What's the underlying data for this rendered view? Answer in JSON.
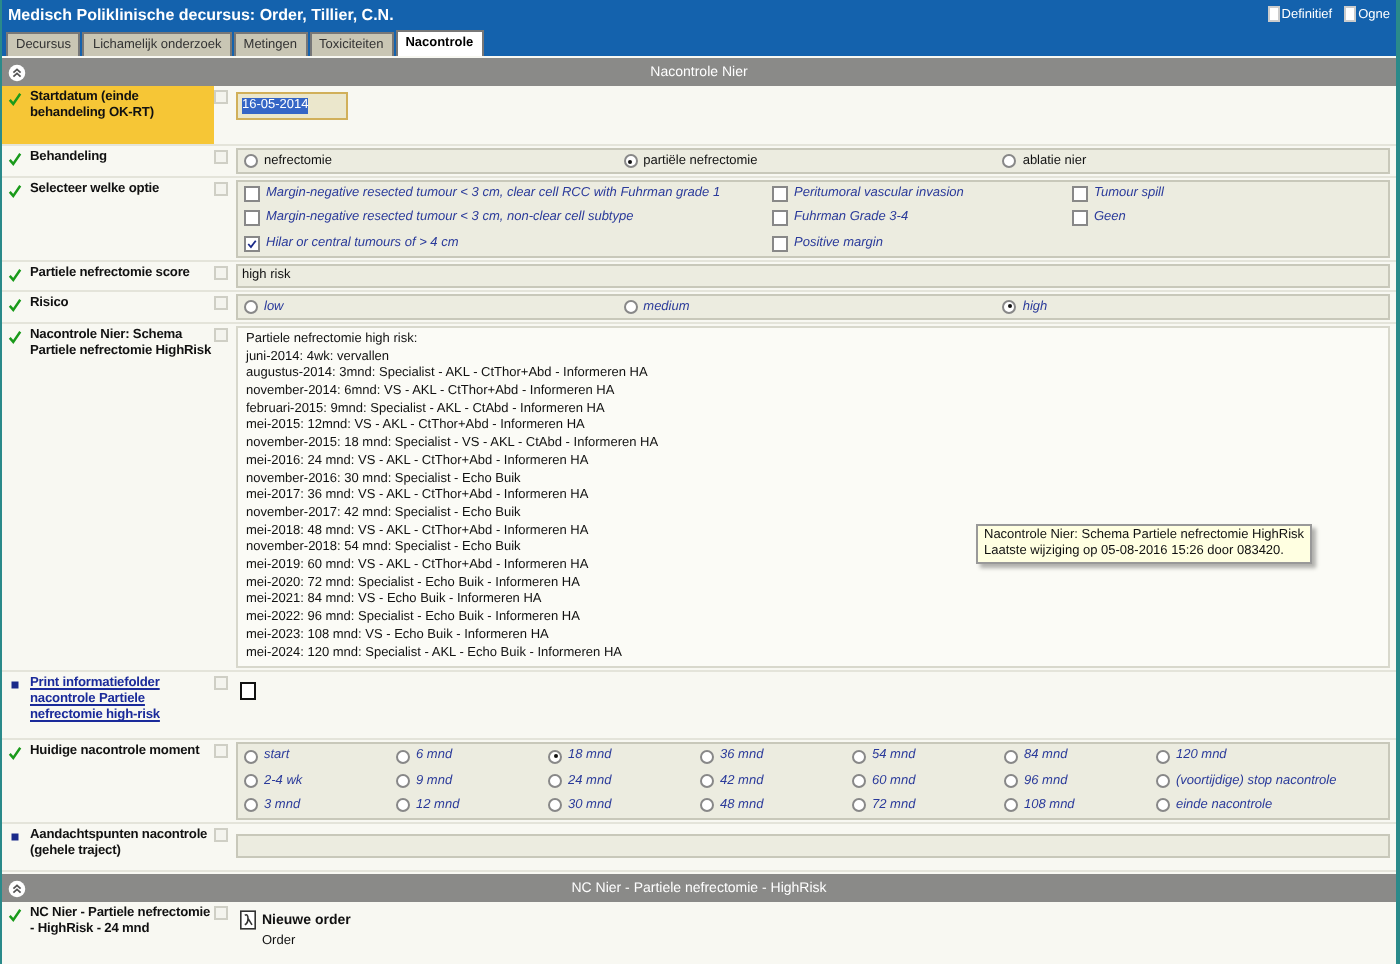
{
  "window": {
    "title": "Medisch Poliklinische decursus: Order, Tillier, C.N.",
    "header_options": [
      {
        "label": "Definitief",
        "checked": false
      },
      {
        "label": "Ogne",
        "checked": false
      }
    ]
  },
  "tabs": [
    {
      "label": "Decursus",
      "selected": false
    },
    {
      "label": "Lichamelijk onderzoek",
      "selected": false
    },
    {
      "label": "Metingen",
      "selected": false
    },
    {
      "label": "Toxiciteiten",
      "selected": false
    },
    {
      "label": "Nacontrole",
      "selected": true
    }
  ],
  "sections": [
    {
      "title": "Nacontrole Nier",
      "expanded": true,
      "rows": [
        {
          "kind": "date",
          "label": "Startdatum (einde behandeling OK-RT)",
          "done": true,
          "highlighted": true,
          "row_checked": false,
          "value": "16-05-2014",
          "text_selected": true
        },
        {
          "kind": "radio",
          "label": "Behandeling",
          "done": true,
          "highlighted": false,
          "row_checked": false,
          "italic": false,
          "options": [
            {
              "label": "nefrectomie",
              "selected": false
            },
            {
              "label": "partiële nefrectomie",
              "selected": true
            },
            {
              "label": "ablatie nier",
              "selected": false
            }
          ]
        },
        {
          "kind": "checks",
          "label": "Selecteer welke optie",
          "done": true,
          "highlighted": false,
          "row_checked": false,
          "columns": [
            [
              {
                "label": "Margin-negative resected tumour < 3 cm, clear cell RCC with Fuhrman grade 1",
                "checked": false
              },
              {
                "label": "Margin-negative resected tumour < 3 cm, non-clear cell subtype",
                "checked": false
              },
              {
                "label": "Hilar or central tumours of > 4 cm",
                "checked": true
              }
            ],
            [
              {
                "label": "Peritumoral vascular invasion",
                "checked": false
              },
              {
                "label": "Fuhrman Grade 3-4",
                "checked": false
              },
              {
                "label": "Positive margin",
                "checked": false
              }
            ],
            [
              {
                "label": "Tumour spill",
                "checked": false
              },
              {
                "label": "Geen",
                "checked": false
              }
            ]
          ]
        },
        {
          "kind": "text",
          "label": "Partiele nefrectomie score",
          "done": true,
          "highlighted": false,
          "row_checked": false,
          "value": "high risk"
        },
        {
          "kind": "radio",
          "label": "Risico",
          "done": true,
          "highlighted": false,
          "row_checked": false,
          "italic": true,
          "options": [
            {
              "label": "low",
              "selected": false
            },
            {
              "label": "medium",
              "selected": false
            },
            {
              "label": "high",
              "selected": true
            }
          ]
        },
        {
          "kind": "schedule",
          "label": "Nacontrole Nier: Schema Partiele nefrectomie HighRisk",
          "done": true,
          "highlighted": false,
          "row_checked": false,
          "lines": [
            "Partiele nefrectomie high risk:",
            "juni-2014: 4wk: vervallen",
            "augustus-2014: 3mnd: Specialist - AKL - CtThor+Abd - Informeren HA",
            "november-2014: 6mnd: VS - AKL - CtThor+Abd - Informeren HA",
            "februari-2015: 9mnd: Specialist - AKL - CtAbd - Informeren HA",
            "mei-2015: 12mnd: VS - AKL - CtThor+Abd - Informeren HA",
            "november-2015: 18 mnd: Specialist - VS - AKL - CtAbd - Informeren HA",
            "mei-2016: 24 mnd: VS - AKL - CtThor+Abd - Informeren HA",
            "november-2016: 30 mnd: Specialist - Echo Buik",
            "mei-2017: 36 mnd: VS - AKL - CtThor+Abd - Informeren HA",
            "november-2017: 42 mnd: Specialist - Echo Buik",
            "mei-2018: 48 mnd: VS - AKL - CtThor+Abd - Informeren HA",
            "november-2018: 54 mnd: Specialist - Echo Buik",
            "mei-2019: 60 mnd: VS - AKL - CtThor+Abd - Informeren HA",
            "mei-2020: 72 mnd: Specialist - Echo Buik - Informeren HA",
            "mei-2021: 84 mnd: VS - Echo Buik - Informeren HA",
            "mei-2022: 96 mnd: Specialist - Echo Buik - Informeren HA",
            "mei-2023: 108 mnd: VS - Echo Buik - Informeren HA",
            "mei-2024: 120 mnd: Specialist - AKL - Echo Buik - Informeren HA"
          ]
        },
        {
          "kind": "print",
          "label": "Print informatiefolder nacontrole Partiele nefrectomie high-risk",
          "done": false,
          "highlighted": false,
          "row_checked": false,
          "checked": false
        },
        {
          "kind": "radiogrid",
          "label": "Huidige nacontrole moment",
          "done": true,
          "highlighted": false,
          "row_checked": false,
          "columns": [
            [
              {
                "label": "start",
                "selected": false
              },
              {
                "label": "2-4 wk",
                "selected": false
              },
              {
                "label": "3 mnd",
                "selected": false
              }
            ],
            [
              {
                "label": "6 mnd",
                "selected": false
              },
              {
                "label": "9 mnd",
                "selected": false
              },
              {
                "label": "12 mnd",
                "selected": false
              }
            ],
            [
              {
                "label": "18 mnd",
                "selected": true
              },
              {
                "label": "24 mnd",
                "selected": false
              },
              {
                "label": "30 mnd",
                "selected": false
              }
            ],
            [
              {
                "label": "36 mnd",
                "selected": false
              },
              {
                "label": "42 mnd",
                "selected": false
              },
              {
                "label": "48 mnd",
                "selected": false
              }
            ],
            [
              {
                "label": "54 mnd",
                "selected": false
              },
              {
                "label": "60 mnd",
                "selected": false
              },
              {
                "label": "72 mnd",
                "selected": false
              }
            ],
            [
              {
                "label": "84 mnd",
                "selected": false
              },
              {
                "label": "96 mnd",
                "selected": false
              },
              {
                "label": "108 mnd",
                "selected": false
              }
            ],
            [
              {
                "label": "120 mnd",
                "selected": false
              },
              {
                "label": "(voortijdige) stop nacontrole",
                "selected": false
              },
              {
                "label": "einde nacontrole",
                "selected": false
              }
            ]
          ]
        },
        {
          "kind": "empty",
          "label": "Aandachtspunten nacontrole (gehele traject)",
          "done": false,
          "highlighted": false,
          "row_checked": false
        }
      ]
    },
    {
      "title": "NC Nier - Partiele nefrectomie - HighRisk",
      "expanded": true,
      "rows": [
        {
          "kind": "order",
          "label": "NC Nier - Partiele nefrectomie - HighRisk - 24 mnd",
          "done": true,
          "highlighted": false,
          "row_checked": false,
          "button": "Nieuwe order",
          "caption": "Order"
        }
      ]
    }
  ],
  "tooltip": {
    "lines": [
      "Nacontrole Nier: Schema Partiele nefrectomie HighRisk",
      "Laatste wijziging op 05-08-2016 15:26 door 083420."
    ]
  }
}
